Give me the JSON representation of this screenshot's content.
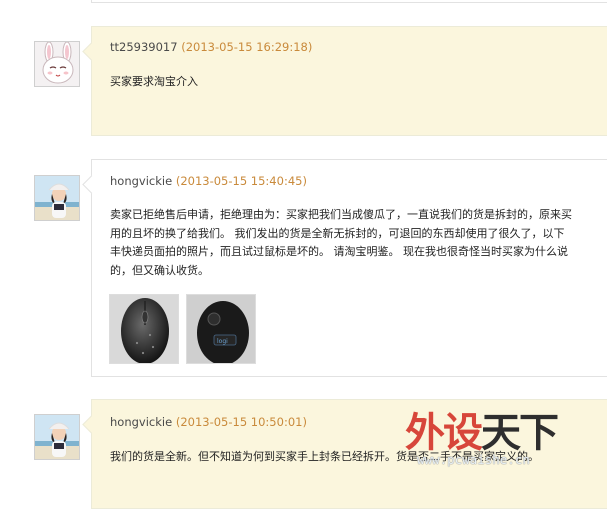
{
  "comments": [
    {
      "user": "tt25939017",
      "time": "(2013-05-15 16:29:18)",
      "lines": [
        "买家要求淘宝介入"
      ]
    },
    {
      "user": "hongvickie",
      "time": "(2013-05-15 15:40:45)",
      "lines": [
        "卖家已拒绝售后申请，拒绝理由为：买家把我们当成傻瓜了，一直说我们的货是拆封的，原来买",
        "用的且坏的换了给我们。 我们发出的货是全新无拆封的，可退回的东西却使用了很久了，以下",
        "丰快递员面拍的照片，而且试过鼠标是坏的。 请淘宝明鉴。 现在我也很奇怪当时买家为什么说",
        "的，但又确认收货。"
      ],
      "images": [
        "mouse-photo-top-icon",
        "mouse-photo-bottom-icon"
      ]
    },
    {
      "user": "hongvickie",
      "time": "(2013-05-15 10:50:01)",
      "lines": [
        "我们的货是全新。但不知道为何到买家手上封条已经拆开。货是否二手不是买家定义的。"
      ]
    }
  ],
  "watermark": {
    "title_part1": "外设",
    "title_part2": "天下",
    "url": "www.pcwaishe.cn"
  }
}
